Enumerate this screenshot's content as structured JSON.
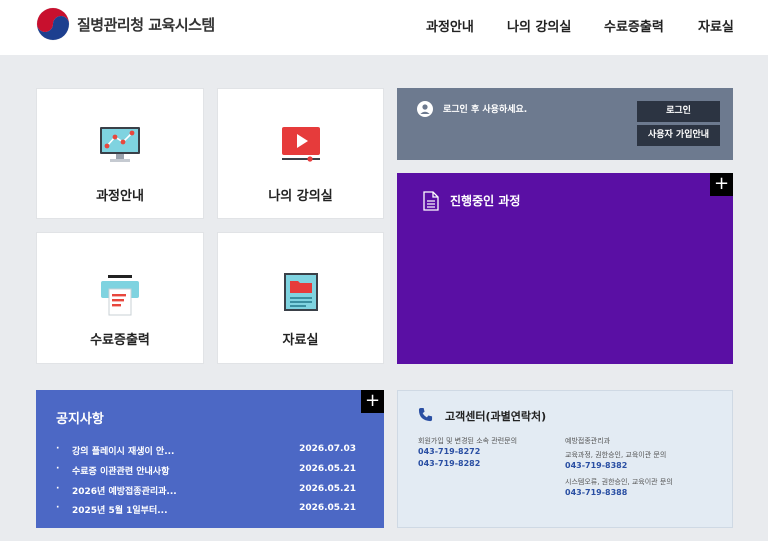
{
  "header": {
    "site_title": "질병관리청 교육시스템",
    "nav": [
      "과정안내",
      "나의 강의실",
      "수료증출력",
      "자료실"
    ]
  },
  "tiles": [
    {
      "label": "과정안내",
      "icon": "monitor-chart-icon"
    },
    {
      "label": "나의 강의실",
      "icon": "video-play-icon"
    },
    {
      "label": "수료증출력",
      "icon": "printer-icon"
    },
    {
      "label": "자료실",
      "icon": "folder-document-icon"
    }
  ],
  "login": {
    "message": "로그인 후 사용하세요.",
    "login_button": "로그인",
    "guide_button": "사용자 가입안내"
  },
  "course": {
    "title": "진행중인 과정",
    "plus": "+"
  },
  "notice": {
    "title": "공지사항",
    "plus": "+",
    "bullet": "·",
    "items": [
      {
        "title": "강의 플레이시 재생이 안...",
        "date": "2026.07.03"
      },
      {
        "title": "수료증 이관관련 안내사항",
        "date": "2026.05.21"
      },
      {
        "title": "2026년 예방접종관리과...",
        "date": "2026.05.21"
      },
      {
        "title": "2025년 5월 1일부터...",
        "date": "2026.05.21"
      }
    ]
  },
  "contact": {
    "title": "고객센터(과별연락처)",
    "left": {
      "desc": "회원가입 및 변경된 소속 관련문의",
      "numbers": [
        "043-719-8272",
        "043-719-8282"
      ]
    },
    "right": {
      "heading": "예방접종관리과",
      "desc1": "교육과정, 권한승인, 교육이관 문의",
      "number1": "043-719-8382",
      "desc2": "시스템오류, 권한승인, 교육이관 문의",
      "number2": "043-719-8388"
    }
  },
  "colors": {
    "course_bg": "#5a0fa4",
    "notice_bg": "#4c68c5",
    "login_bg": "#6d7a8f",
    "contact_bg": "#e3ebf3"
  }
}
